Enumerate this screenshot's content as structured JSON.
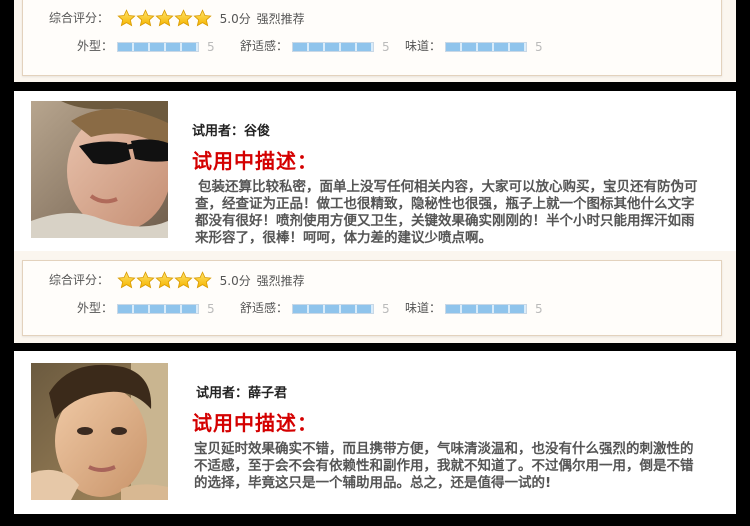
{
  "rating_labels": {
    "overall": "综合评分：",
    "appearance": "外型：",
    "comfort": "舒适感：",
    "smell": "味道："
  },
  "review_blocks": [
    {
      "rating": {
        "stars": 5,
        "score_text": "5.0分",
        "verdict": "强烈推荐",
        "appearance": {
          "value": 5,
          "fraction": 1.0
        },
        "comfort": {
          "value": 5,
          "fraction": 1.0
        },
        "smell": {
          "value": 5,
          "fraction": 1.0
        }
      }
    },
    {
      "user_label": "试用者：",
      "user_name": "谷俊",
      "title": "试用中描述：",
      "text": "包装还算比较私密，面单上没写任何相关内容，大家可以放心购买，宝贝还有防伪可查，经查证为正品！做工也很精致，隐秘性也很强，瓶子上就一个图标其他什么文字都没有很好！喷剂使用方便又卫生，关键效果确实刚刚的！半个小时只能用挥汗如雨来形容了，很棒！呵呵，体力差的建议少喷点啊。",
      "rating": {
        "stars": 5,
        "score_text": "5.0分",
        "verdict": "强烈推荐",
        "appearance": {
          "value": 5,
          "fraction": 1.0
        },
        "comfort": {
          "value": 5,
          "fraction": 1.0
        },
        "smell": {
          "value": 5,
          "fraction": 1.0
        }
      }
    },
    {
      "user_label": "试用者：",
      "user_name": "薛子君",
      "title": "试用中描述：",
      "text": "宝贝延时效果确实不错，而且携带方便，气味清淡温和，也没有什么强烈的刺激性的不适感，至于会不会有依赖性和副作用，我就不知道了。不过偶尔用一用，倒是不错的选择，毕竟这只是一个辅助用品。总之，还是值得一试的!"
    }
  ],
  "colors": {
    "title_red": "#d40000",
    "star_gold": "#f5b400",
    "bar_blue": "#8fc4ec",
    "page_bg": "#000000"
  },
  "icons": [
    "star-icon"
  ]
}
